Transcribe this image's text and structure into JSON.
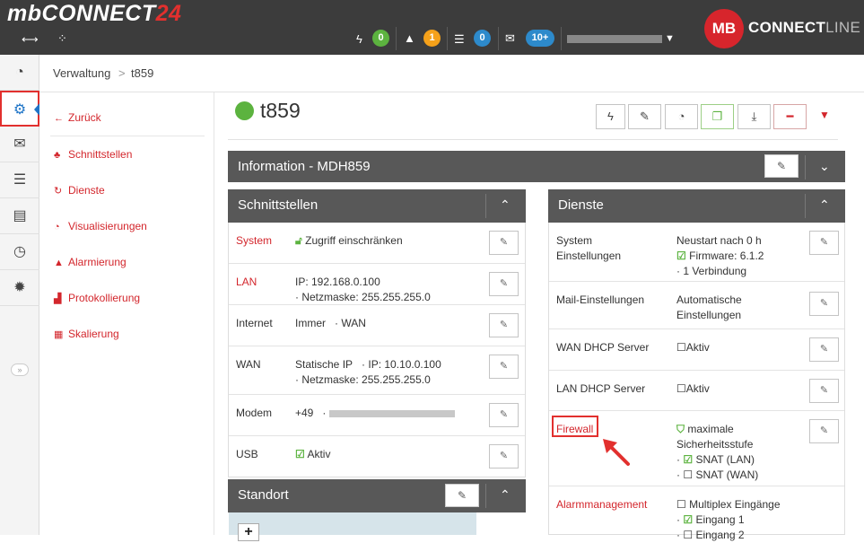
{
  "app": {
    "logo_prefix": "mb",
    "logo_main": "CONNECT",
    "logo_suffix": "24",
    "brand_mark": "MB",
    "brand_name_bold": "CONNECT",
    "brand_name_light": "LINE"
  },
  "topbar": {
    "badges": {
      "lightning": "0",
      "warning": "1",
      "server": "0",
      "mail": "10+"
    },
    "colors": {
      "lightning": "#5cb33f",
      "warning": "#f5a11a",
      "server": "#2d8acb",
      "mail": "#2d8acb"
    }
  },
  "breadcrumb": {
    "root": "Verwaltung",
    "separator": ">",
    "current": "t859"
  },
  "subnav": {
    "back": "Zurück",
    "items": [
      "Schnittstellen",
      "Dienste",
      "Visualisierungen",
      "Alarmierung",
      "Protokollierung",
      "Skalierung"
    ]
  },
  "device": {
    "name": "t859",
    "status_color": "#5cb33f"
  },
  "info_panel": {
    "title": "Information - MDH859"
  },
  "interfaces": {
    "title": "Schnittstellen",
    "rows": [
      {
        "label": "System",
        "value": "Zugriff einschränken"
      },
      {
        "label": "LAN",
        "line1": "IP: 192.168.0.100",
        "line2": "· Netzmaske: 255.255.255.0"
      },
      {
        "label": "Internet",
        "line1": "Immer",
        "line1b": "· WAN"
      },
      {
        "label": "WAN",
        "line1": "Statische IP",
        "line1b": "· IP: 10.10.0.100",
        "line2": "· Netzmaske: 255.255.255.0"
      },
      {
        "label": "Modem",
        "line1": "+49",
        "line1b": "·"
      },
      {
        "label": "USB",
        "value": "Aktiv"
      }
    ]
  },
  "location": {
    "title": "Standort",
    "zoom_in": "+"
  },
  "services": {
    "title": "Dienste",
    "rows": [
      {
        "label_l1": "System",
        "label_l2": "Einstellungen",
        "v1": "Neustart nach 0 h",
        "v2": "Firmware: 6.1.2",
        "v3": "· 1 Verbindung"
      },
      {
        "label": "Mail-Einstellungen",
        "v1": "Automatische",
        "v2": "Einstellungen"
      },
      {
        "label": "WAN DHCP Server",
        "v1": "Aktiv"
      },
      {
        "label": "LAN DHCP Server",
        "v1": "Aktiv"
      },
      {
        "label": "Firewall",
        "v1": "maximale",
        "v2": "Sicherheitsstufe",
        "v3": "SNAT (LAN)",
        "v4": "SNAT (WAN)"
      },
      {
        "label": "Alarmmanagement",
        "v1": "Multiplex Eingänge",
        "v2": "Eingang 1",
        "v3": "Eingang 2"
      }
    ]
  }
}
